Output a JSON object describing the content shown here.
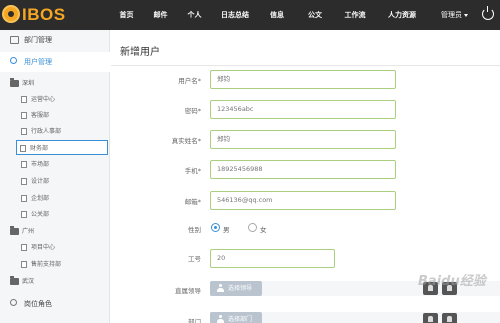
{
  "brand": {
    "logo_text": "IBOS"
  },
  "nav": {
    "items": [
      {
        "label": "首页"
      },
      {
        "label": "邮件"
      },
      {
        "label": "个人"
      },
      {
        "label": "日志总结"
      },
      {
        "label": "信息"
      },
      {
        "label": "公文"
      },
      {
        "label": "工作流"
      },
      {
        "label": "人力资源"
      }
    ],
    "user_menu": "管理员"
  },
  "sidebar": {
    "dept_manage": "部门管理",
    "user_manage": "用户管理",
    "tree": [
      {
        "kind": "folder",
        "label": "深圳"
      },
      {
        "kind": "item",
        "label": "运营中心"
      },
      {
        "kind": "item",
        "label": "客服部"
      },
      {
        "kind": "item",
        "label": "行政人事部"
      },
      {
        "kind": "item",
        "label": "财务部",
        "selected": true
      },
      {
        "kind": "item",
        "label": "市场部"
      },
      {
        "kind": "item",
        "label": "设计部"
      },
      {
        "kind": "item",
        "label": "企划部"
      },
      {
        "kind": "item",
        "label": "公关部"
      },
      {
        "kind": "folder",
        "label": "广州"
      },
      {
        "kind": "item",
        "label": "项目中心"
      },
      {
        "kind": "item",
        "label": "售前支持部"
      },
      {
        "kind": "folder",
        "label": "武汉"
      }
    ],
    "position_role": "岗位角色"
  },
  "form": {
    "title": "新增用户",
    "username": {
      "label": "用户名*",
      "value": "郑钧"
    },
    "password": {
      "label": "密码*",
      "value": "123456abc"
    },
    "realname": {
      "label": "真实姓名*",
      "value": "郑钧"
    },
    "mobile": {
      "label": "手机*",
      "value": "18925456988"
    },
    "email": {
      "label": "邮箱*",
      "value": "546136@qq.com"
    },
    "gender": {
      "label": "性别",
      "options": [
        "男",
        "女"
      ],
      "selected": "男"
    },
    "job_no": {
      "label": "工号",
      "value": "20"
    },
    "supervisor": {
      "label": "直属领导",
      "button": "选择领导"
    },
    "department": {
      "label": "部门",
      "button": "选择部门"
    }
  },
  "watermark": "Baidu经验"
}
